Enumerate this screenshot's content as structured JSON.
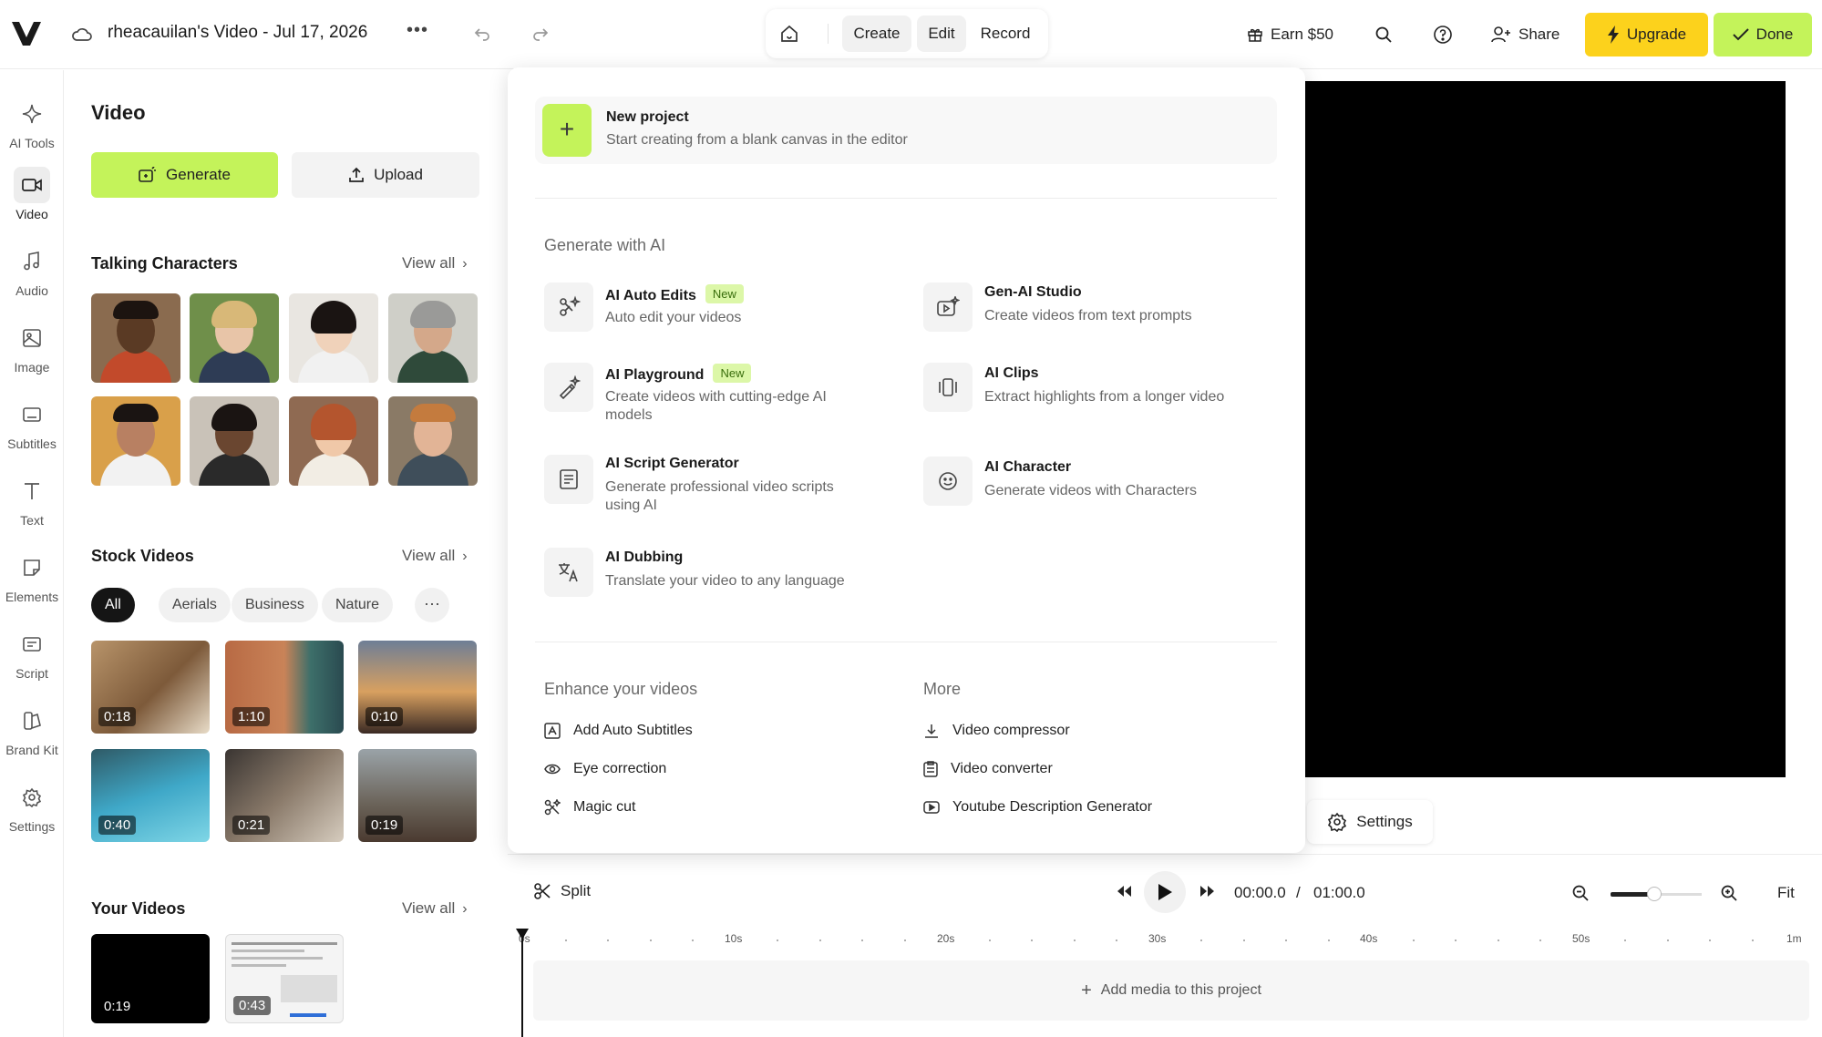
{
  "header": {
    "project_title": "rheacauilan's Video - Jul 17, 2026",
    "more_icon": "more-horizontal-icon",
    "modes": {
      "create": "Create",
      "edit": "Edit",
      "record": "Record"
    },
    "earn_label": "Earn $50",
    "share_label": "Share",
    "upgrade_label": "Upgrade",
    "done_label": "Done"
  },
  "colors": {
    "accent_green": "#c4f35a",
    "upgrade_yellow": "#fcd21c",
    "badge_bg": "#dcf7a8"
  },
  "rail": {
    "items": [
      {
        "label": "AI Tools",
        "icon": "sparkle-icon"
      },
      {
        "label": "Video",
        "icon": "video-camera-icon"
      },
      {
        "label": "Audio",
        "icon": "music-note-icon"
      },
      {
        "label": "Image",
        "icon": "image-icon"
      },
      {
        "label": "Subtitles",
        "icon": "subtitles-icon"
      },
      {
        "label": "Text",
        "icon": "text-icon"
      },
      {
        "label": "Elements",
        "icon": "elements-icon"
      },
      {
        "label": "Script",
        "icon": "script-icon"
      },
      {
        "label": "Brand Kit",
        "icon": "brand-kit-icon"
      },
      {
        "label": "Settings",
        "icon": "gear-icon"
      }
    ]
  },
  "panel": {
    "title": "Video",
    "generate_label": "Generate",
    "upload_label": "Upload",
    "talking_title": "Talking Characters",
    "stock_title": "Stock Videos",
    "your_title": "Your Videos",
    "view_all": "View all",
    "chips": [
      "All",
      "Aerials",
      "Business",
      "Nature"
    ],
    "stock_durations": [
      "0:18",
      "1:10",
      "0:10",
      "0:40",
      "0:21",
      "0:19"
    ],
    "your_durations": [
      "0:19",
      "0:43"
    ]
  },
  "dropdown": {
    "new_project_title": "New project",
    "new_project_sub": "Start creating from a blank canvas in the editor",
    "gen_ai_title": "Generate with AI",
    "options": {
      "auto_edits": {
        "title": "AI Auto Edits",
        "sub": "Auto edit your videos",
        "badge": "New"
      },
      "playground": {
        "title": "AI Playground",
        "sub": "Create videos with cutting-edge AI models",
        "badge": "New"
      },
      "script_gen": {
        "title": "AI Script Generator",
        "sub": "Generate professional video scripts using AI"
      },
      "dubbing": {
        "title": "AI Dubbing",
        "sub": "Translate your video to any language"
      },
      "gen_studio": {
        "title": "Gen-AI Studio",
        "sub": "Create videos from text prompts"
      },
      "clips": {
        "title": "AI Clips",
        "sub": "Extract highlights from a longer video"
      },
      "character": {
        "title": "AI Character",
        "sub": "Generate videos with Characters"
      }
    },
    "enhance_title": "Enhance your videos",
    "enhance_items": [
      "Add Auto Subtitles",
      "Eye correction",
      "Magic cut"
    ],
    "more_title": "More",
    "more_items": [
      "Video compressor",
      "Video converter",
      "Youtube Description Generator"
    ]
  },
  "preview": {
    "settings_label": "Settings"
  },
  "timeline": {
    "split_label": "Split",
    "current_time": "00:00.0",
    "separator": "/",
    "total_time": "01:00.0",
    "fit_label": "Fit",
    "tick_labels": [
      "0s",
      "10s",
      "20s",
      "30s",
      "40s",
      "50s",
      "1m"
    ],
    "add_media_label": "Add media to this project"
  }
}
